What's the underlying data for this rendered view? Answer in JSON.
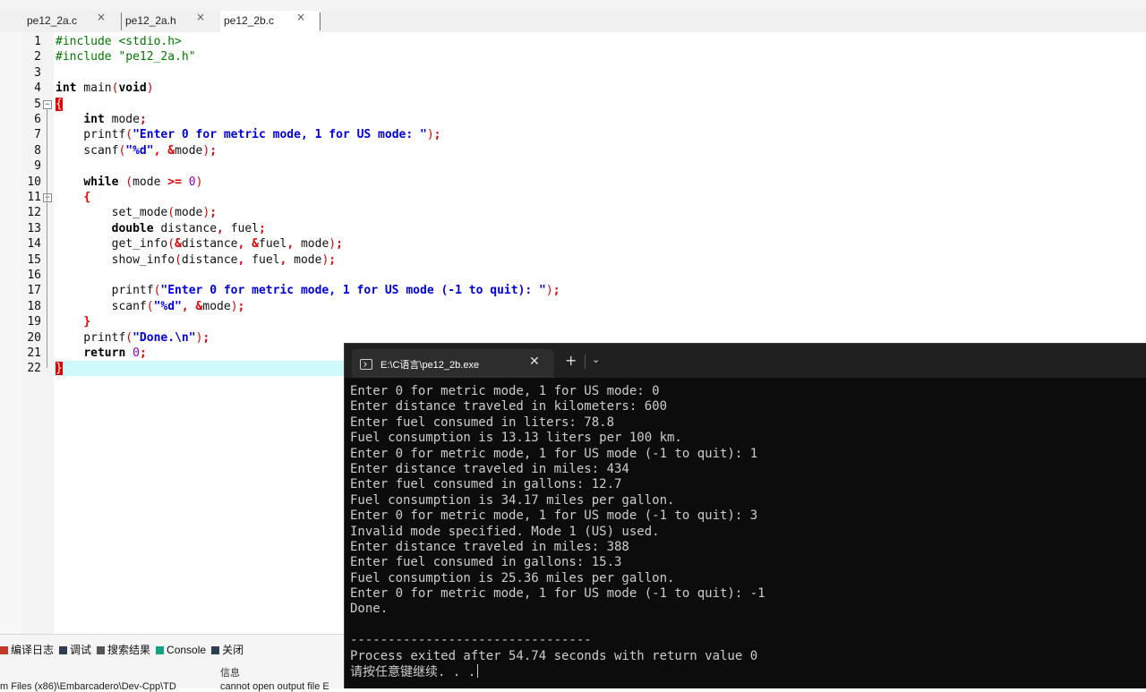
{
  "tabs": [
    {
      "label": "pe12_2a.c",
      "active": false
    },
    {
      "label": "pe12_2a.h",
      "active": false
    },
    {
      "label": "pe12_2b.c",
      "active": true
    }
  ],
  "tab_close_glyph": "×",
  "editor": {
    "current_line": 22,
    "lines": [
      {
        "n": "1",
        "text": "#include <stdio.h>"
      },
      {
        "n": "2",
        "text": "#include \"pe12_2a.h\""
      },
      {
        "n": "3",
        "text": ""
      },
      {
        "n": "4",
        "text": "int main(void)"
      },
      {
        "n": "5",
        "text": "{"
      },
      {
        "n": "6",
        "text": "    int mode;"
      },
      {
        "n": "7",
        "text": "    printf(\"Enter 0 for metric mode, 1 for US mode: \");"
      },
      {
        "n": "8",
        "text": "    scanf(\"%d\", &mode);"
      },
      {
        "n": "9",
        "text": ""
      },
      {
        "n": "10",
        "text": "    while (mode >= 0)"
      },
      {
        "n": "11",
        "text": "    {"
      },
      {
        "n": "12",
        "text": "        set_mode(mode);"
      },
      {
        "n": "13",
        "text": "        double distance, fuel;"
      },
      {
        "n": "14",
        "text": "        get_info(&distance, &fuel, mode);"
      },
      {
        "n": "15",
        "text": "        show_info(distance, fuel, mode);"
      },
      {
        "n": "16",
        "text": ""
      },
      {
        "n": "17",
        "text": "        printf(\"Enter 0 for metric mode, 1 for US mode (-1 to quit): \");"
      },
      {
        "n": "18",
        "text": "        scanf(\"%d\", &mode);"
      },
      {
        "n": "19",
        "text": "    }"
      },
      {
        "n": "20",
        "text": "    printf(\"Done.\\n\");"
      },
      {
        "n": "21",
        "text": "    return 0;"
      },
      {
        "n": "22",
        "text": "}"
      }
    ]
  },
  "bottom_panel": {
    "tabs": [
      {
        "label": "编译日志",
        "icon": "compile-log-icon",
        "color": "#c0392b"
      },
      {
        "label": "调试",
        "icon": "debug-icon",
        "color": "#2c3e50"
      },
      {
        "label": "搜索结果",
        "icon": "search-results-icon",
        "color": "#555555"
      },
      {
        "label": "Console",
        "icon": "console-icon",
        "color": "#16a085"
      },
      {
        "label": "关闭",
        "icon": "close-panel-icon",
        "color": "#2c3e50"
      }
    ],
    "header_info": "信息",
    "row_file": "m Files (x86)\\Embarcadero\\Dev-Cpp\\TD",
    "row_message": "cannot open output file E"
  },
  "console": {
    "title": "E:\\C语言\\pe12_2b.exe",
    "close_glyph": "✕",
    "plus_glyph": "+",
    "chevron_glyph": "⌄",
    "lines": [
      "Enter 0 for metric mode, 1 for US mode: 0",
      "Enter distance traveled in kilometers: 600",
      "Enter fuel consumed in liters: 78.8",
      "Fuel consumption is 13.13 liters per 100 km.",
      "Enter 0 for metric mode, 1 for US mode (-1 to quit): 1",
      "Enter distance traveled in miles: 434",
      "Enter fuel consumed in gallons: 12.7",
      "Fuel consumption is 34.17 miles per gallon.",
      "Enter 0 for metric mode, 1 for US mode (-1 to quit): 3",
      "Invalid mode specified. Mode 1 (US) used.",
      "Enter distance traveled in miles: 388",
      "Enter fuel consumed in gallons: 15.3",
      "Fuel consumption is 25.36 miles per gallon.",
      "Enter 0 for metric mode, 1 for US mode (-1 to quit): -1",
      "Done.",
      "",
      "--------------------------------",
      "Process exited after 54.74 seconds with return value 0",
      "请按任意键继续. . ."
    ]
  }
}
